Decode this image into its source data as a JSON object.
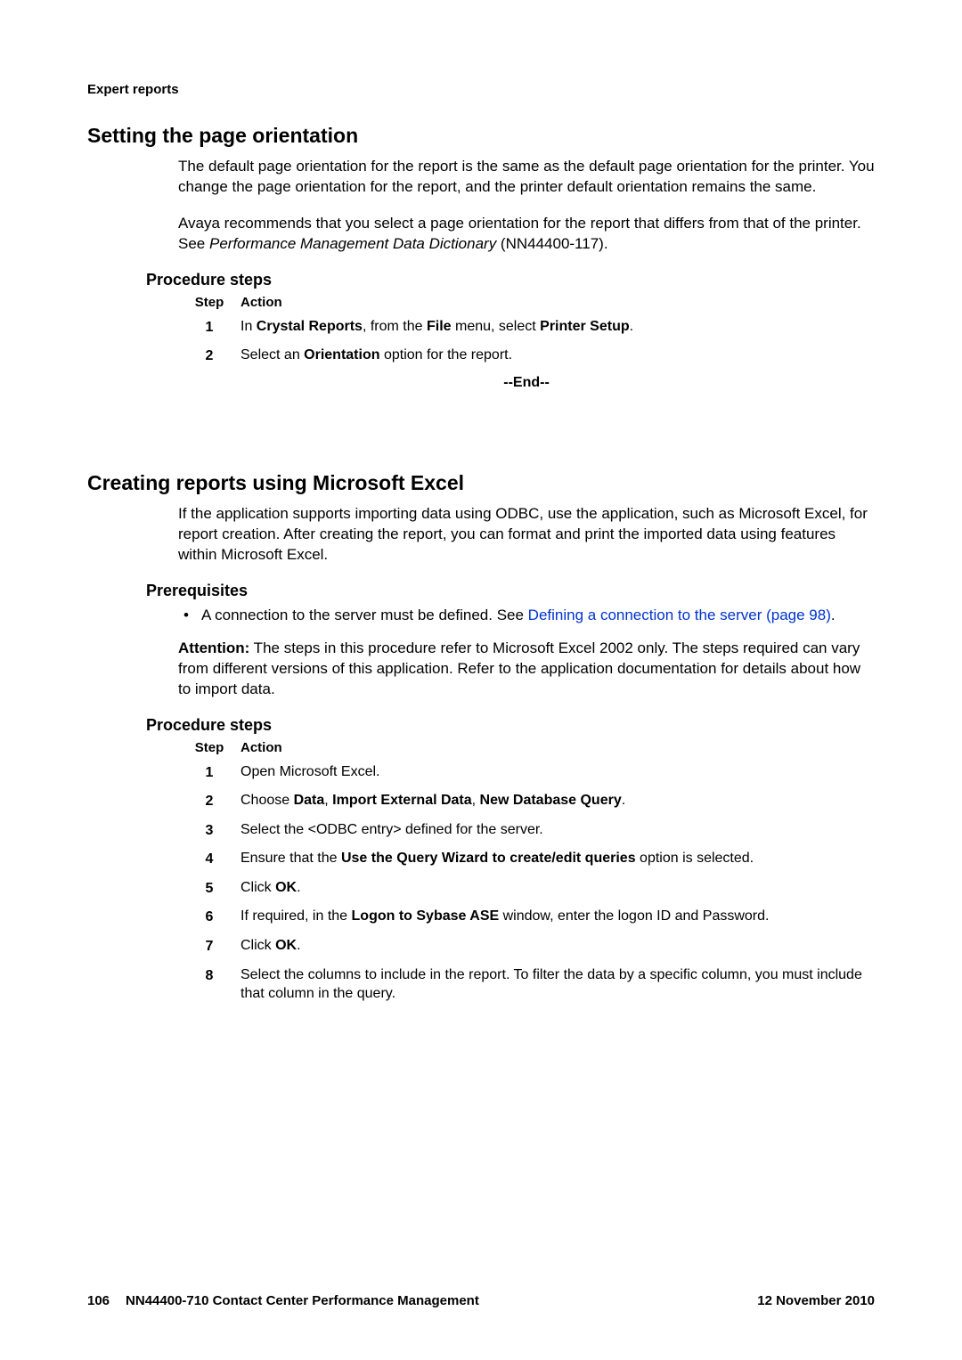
{
  "running_head": "Expert reports",
  "section1": {
    "title": "Setting the page orientation",
    "para1": "The default page orientation for the report is the same as the default page orientation for the printer. You change the page orientation for the report, and the printer default orientation remains the same.",
    "para2_pre": "Avaya recommends that you select a page orientation for the report that differs from that of the printer. See ",
    "para2_cite": "Performance Management Data Dictionary",
    "para2_post": " (NN44400-117).",
    "proc_heading": "Procedure steps",
    "steps_head_step": "Step",
    "steps_head_action": "Action",
    "steps": [
      {
        "num": "1",
        "parts": {
          "t1": "In ",
          "b1": "Crystal Reports",
          "t2": ", from the ",
          "b2": "File",
          "t3": " menu, select ",
          "b3": "Printer Setup",
          "t4": "."
        }
      },
      {
        "num": "2",
        "parts": {
          "t1": "Select an ",
          "b1": "Orientation",
          "t2": " option for the report."
        }
      }
    ],
    "end": "--End--"
  },
  "section2": {
    "title": "Creating reports using Microsoft Excel",
    "para1": "If the application supports importing data using ODBC, use the application, such as Microsoft Excel, for report creation. After creating the report, you can format and print the imported data using features within Microsoft Excel.",
    "prereq_heading": "Prerequisites",
    "bullet_dot": "•",
    "bullet_text_pre": "A connection to the server must be defined. See ",
    "bullet_link": "Defining a connection to the server (page 98)",
    "bullet_text_post": ".",
    "attention_label": "Attention:",
    "attention_text": "  The steps in this procedure refer to Microsoft Excel 2002 only. The steps required can vary from different versions of this application. Refer to the application documentation for details about how to import data.",
    "proc_heading": "Procedure steps",
    "steps_head_step": "Step",
    "steps_head_action": "Action",
    "steps": [
      {
        "num": "1",
        "plain": "Open Microsoft Excel."
      },
      {
        "num": "2",
        "parts": {
          "t1": "Choose ",
          "b1": "Data",
          "t2": ", ",
          "b2": "Import External Data",
          "t3": ", ",
          "b3": "New Database Query",
          "t4": "."
        }
      },
      {
        "num": "3",
        "plain": "Select the <ODBC entry> defined for the server."
      },
      {
        "num": "4",
        "parts": {
          "t1": "Ensure that the ",
          "b1": "Use the Query Wizard to create/edit queries",
          "t2": " option is selected."
        }
      },
      {
        "num": "5",
        "parts": {
          "t1": "Click ",
          "b1": "OK",
          "t2": "."
        }
      },
      {
        "num": "6",
        "parts": {
          "t1": "If required, in the ",
          "b1": "Logon to Sybase ASE",
          "t2": " window, enter the logon ID and Password."
        }
      },
      {
        "num": "7",
        "parts": {
          "t1": "Click ",
          "b1": "OK",
          "t2": "."
        }
      },
      {
        "num": "8",
        "plain": "Select the columns to include in the report. To filter the data by a specific column, you must include that column in the query."
      }
    ]
  },
  "footer": {
    "pagenum": "106",
    "doc": "NN44400-710 Contact Center Performance Management",
    "date": "12 November 2010"
  }
}
